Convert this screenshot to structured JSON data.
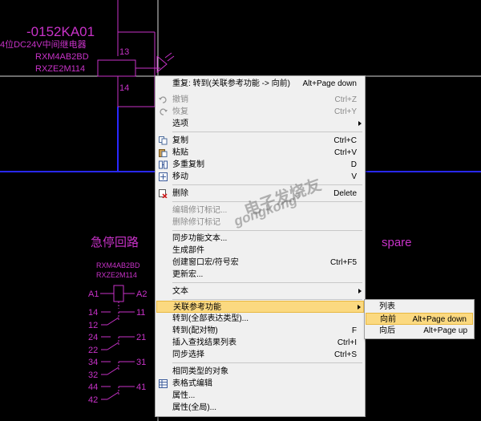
{
  "schematic": {
    "device_tag": "-0152KA01",
    "device_desc": "4位DC24V中间继电器",
    "part_1": "RXM4AB2BD",
    "part_2": "RXZE2M114",
    "pin_top": "13",
    "pin_bottom": "14",
    "heading_left": "急停回路",
    "heading_right": "spare",
    "relay_part_1": "RXM4AB2BD",
    "relay_part_2": "RXZE2M114",
    "coil_a1": "A1",
    "coil_a2": "A2",
    "contacts": [
      {
        "left_top": "14",
        "left_bottom": "12",
        "right": "11"
      },
      {
        "left_top": "24",
        "left_bottom": "22",
        "right": "21"
      },
      {
        "left_top": "34",
        "left_bottom": "32",
        "right": "31"
      },
      {
        "left_top": "44",
        "left_bottom": "42",
        "right": "41"
      }
    ],
    "colors": {
      "wire": "#2828ff",
      "symbol": "#c832c8",
      "crosshair": "#d8d8d8"
    }
  },
  "watermark": {
    "line1": "电子发烧友",
    "line2": "gongkong",
    "mark": "®"
  },
  "context_menu": {
    "items": [
      {
        "label": "重复: 转到(关联参考功能 -> 向前)",
        "shortcut": "Alt+Page down",
        "icon": ""
      },
      {
        "label": "撤销",
        "shortcut": "Ctrl+Z",
        "icon": "undo-icon",
        "disabled": true
      },
      {
        "label": "恢复",
        "shortcut": "Ctrl+Y",
        "icon": "redo-icon",
        "disabled": true
      },
      {
        "label": "选项",
        "shortcut": "",
        "icon": "",
        "submenu": true
      },
      {
        "label": "复制",
        "shortcut": "Ctrl+C",
        "icon": "copy-icon"
      },
      {
        "label": "粘贴",
        "shortcut": "Ctrl+V",
        "icon": "paste-icon"
      },
      {
        "label": "多重复制",
        "shortcut": "D",
        "icon": "multi-copy-icon"
      },
      {
        "label": "移动",
        "shortcut": "V",
        "icon": "move-icon"
      },
      {
        "label": "删除",
        "shortcut": "Delete",
        "icon": "delete-icon"
      },
      {
        "label": "编辑修订标记...",
        "shortcut": "",
        "icon": "",
        "disabled": true
      },
      {
        "label": "删除修订标记",
        "shortcut": "",
        "icon": "",
        "disabled": true
      },
      {
        "label": "同步功能文本...",
        "shortcut": "",
        "icon": ""
      },
      {
        "label": "生成部件",
        "shortcut": "",
        "icon": ""
      },
      {
        "label": "创建窗口宏/符号宏",
        "shortcut": "Ctrl+F5",
        "icon": ""
      },
      {
        "label": "更新宏...",
        "shortcut": "",
        "icon": ""
      },
      {
        "label": "文本",
        "shortcut": "",
        "icon": "",
        "submenu": true
      },
      {
        "label": "关联参考功能",
        "shortcut": "",
        "icon": "",
        "submenu": true,
        "highlighted": true
      },
      {
        "label": "转到(全部表达类型)...",
        "shortcut": "",
        "icon": ""
      },
      {
        "label": "转到(配对物)",
        "shortcut": "F",
        "icon": ""
      },
      {
        "label": "插入查找结果列表",
        "shortcut": "Ctrl+I",
        "icon": ""
      },
      {
        "label": "同步选择",
        "shortcut": "Ctrl+S",
        "icon": ""
      },
      {
        "label": "相同类型的对象",
        "shortcut": "",
        "icon": ""
      },
      {
        "label": "表格式编辑",
        "shortcut": "",
        "icon": "table-edit-icon"
      },
      {
        "label": "属性...",
        "shortcut": "",
        "icon": ""
      },
      {
        "label": "属性(全局)...",
        "shortcut": "",
        "icon": ""
      }
    ]
  },
  "submenu": {
    "items": [
      {
        "label": "列表",
        "shortcut": ""
      },
      {
        "label": "向前",
        "shortcut": "Alt+Page down",
        "highlighted": true
      },
      {
        "label": "向后",
        "shortcut": "Alt+Page up"
      }
    ]
  }
}
